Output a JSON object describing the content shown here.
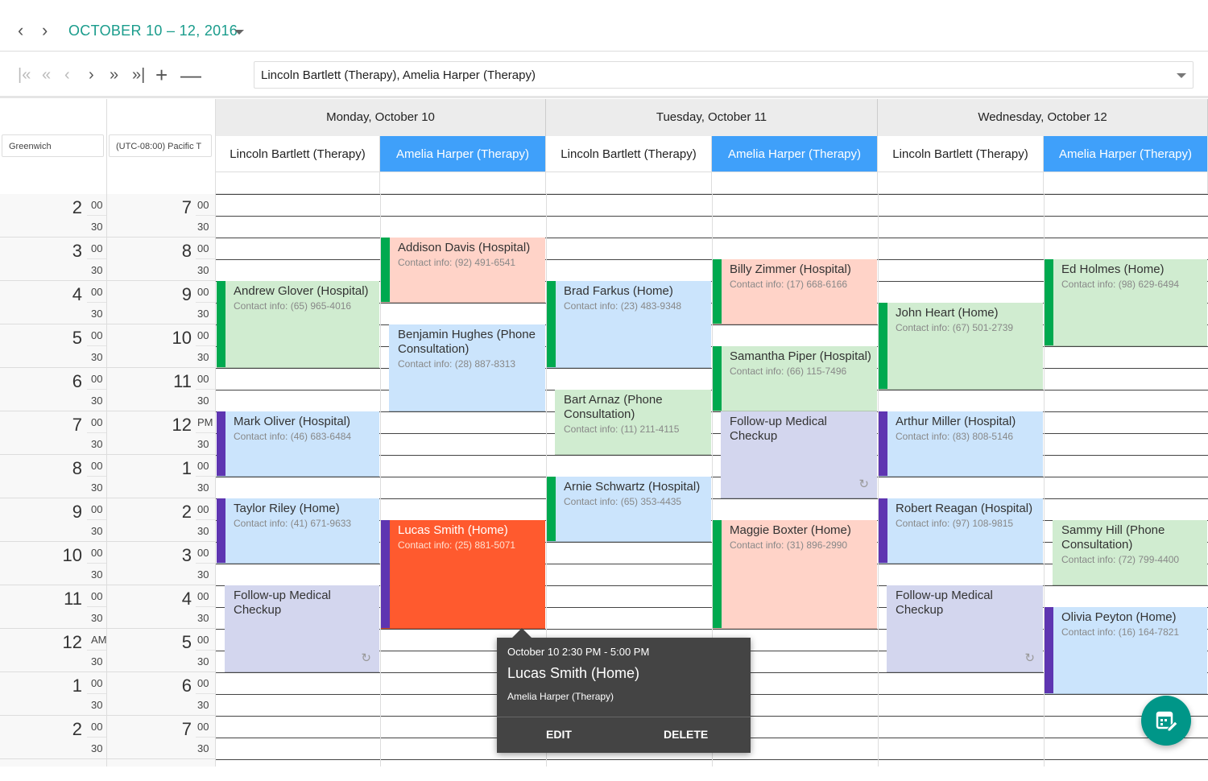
{
  "header": {
    "date_range": "OCTOBER 10 – 12, 2016",
    "prev_icon": "chevron-left-icon",
    "next_icon": "chevron-right-icon"
  },
  "toolbar": {
    "resources_value": "Lincoln Bartlett (Therapy), Amelia Harper (Therapy)"
  },
  "timezones": [
    "Greenwich",
    "(UTC-08:00) Pacific T"
  ],
  "days": [
    "Monday, October 10",
    "Tuesday, October 11",
    "Wednesday, October 12"
  ],
  "resources": [
    "Lincoln Bartlett (Therapy)",
    "Amelia Harper (Therapy)"
  ],
  "selected_resource": 1,
  "time_scale": {
    "greenwich": [
      "2",
      "3",
      "4",
      "5",
      "6",
      "7",
      "8",
      "9",
      "10",
      "11",
      "12",
      "1",
      "2"
    ],
    "pacific": [
      "7",
      "8",
      "9",
      "10",
      "11",
      "12",
      "1",
      "2",
      "3",
      "4",
      "5",
      "6",
      "7"
    ],
    "greenwich_suffix": {
      "10": "AM"
    },
    "pacific_suffix": {
      "5": "PM"
    },
    "minutes": [
      "00",
      "30"
    ]
  },
  "colors": {
    "green_bg": "#d0ecd0",
    "pink_bg": "#ffd3c8",
    "blue_bg": "#cbe4fc",
    "lavender_bg": "#d3d6ee",
    "orange_bg": "#ff5a2e",
    "green_strip": "#00a94f",
    "purple_strip": "#5e35b1",
    "selected_resource": "#3fa0fa",
    "accent": "#1a9c8c",
    "fab": "#009688"
  },
  "appointments": [
    {
      "day": 0,
      "res": 0,
      "start": 9,
      "end": 11,
      "title": "Andrew Glover (Hospital)",
      "contact": "Contact info: (65) 965-4016",
      "bg": "green_bg",
      "strip": "green_strip"
    },
    {
      "day": 0,
      "res": 0,
      "start": 12,
      "end": 13.5,
      "title": "Mark Oliver (Hospital)",
      "contact": "Contact info: (46) 683-6484",
      "bg": "blue_bg",
      "strip": "purple_strip"
    },
    {
      "day": 0,
      "res": 0,
      "start": 14,
      "end": 15.5,
      "title": "Taylor Riley (Home)",
      "contact": "Contact info: (41) 671-9633",
      "bg": "blue_bg",
      "strip": "purple_strip"
    },
    {
      "day": 0,
      "res": 0,
      "start": 16,
      "end": 18,
      "title": "Follow-up Medical Checkup",
      "contact": "",
      "bg": "lavender_bg",
      "strip": null,
      "recurring": true
    },
    {
      "day": 0,
      "res": 1,
      "start": 8,
      "end": 9.5,
      "title": "Addison Davis (Hospital)",
      "contact": "Contact info: (92) 491-6541",
      "bg": "pink_bg",
      "strip": "green_strip"
    },
    {
      "day": 0,
      "res": 1,
      "start": 10,
      "end": 12,
      "title": "Benjamin Hughes (Phone Consultation)",
      "contact": "Contact info: (28) 887-8313",
      "bg": "blue_bg",
      "strip": null
    },
    {
      "day": 0,
      "res": 1,
      "start": 14.5,
      "end": 17,
      "title": "Lucas Smith (Home)",
      "contact": "Contact info: (25) 881-5071",
      "bg": "orange_bg",
      "strip": "purple_strip",
      "selected": true
    },
    {
      "day": 1,
      "res": 0,
      "start": 9,
      "end": 11,
      "title": "Brad Farkus (Home)",
      "contact": "Contact info: (23) 483-9348",
      "bg": "blue_bg",
      "strip": "green_strip"
    },
    {
      "day": 1,
      "res": 0,
      "start": 11.5,
      "end": 13,
      "title": "Bart Arnaz (Phone Consultation)",
      "contact": "Contact info: (11) 211-4115",
      "bg": "green_bg",
      "strip": null
    },
    {
      "day": 1,
      "res": 0,
      "start": 13.5,
      "end": 15,
      "title": "Arnie Schwartz (Hospital)",
      "contact": "Contact info: (65) 353-4435",
      "bg": "blue_bg",
      "strip": "green_strip"
    },
    {
      "day": 1,
      "res": 1,
      "start": 8.5,
      "end": 10,
      "title": "Billy Zimmer (Hospital)",
      "contact": "Contact info: (17) 668-6166",
      "bg": "pink_bg",
      "strip": "green_strip"
    },
    {
      "day": 1,
      "res": 1,
      "start": 10.5,
      "end": 12,
      "title": "Samantha Piper (Hospital)",
      "contact": "Contact info: (66) 115-7496",
      "bg": "green_bg",
      "strip": "green_strip"
    },
    {
      "day": 1,
      "res": 1,
      "start": 12,
      "end": 14,
      "title": "Follow-up Medical Checkup",
      "contact": "",
      "bg": "lavender_bg",
      "strip": null,
      "recurring": true
    },
    {
      "day": 1,
      "res": 1,
      "start": 14.5,
      "end": 17,
      "title": "Maggie Boxter (Home)",
      "contact": "Contact info: (31) 896-2990",
      "bg": "pink_bg",
      "strip": "green_strip"
    },
    {
      "day": 2,
      "res": 0,
      "start": 9.5,
      "end": 11.5,
      "title": "John Heart (Home)",
      "contact": "Contact info: (67) 501-2739",
      "bg": "green_bg",
      "strip": "green_strip"
    },
    {
      "day": 2,
      "res": 0,
      "start": 12,
      "end": 13.5,
      "title": "Arthur Miller (Hospital)",
      "contact": "Contact info: (83) 808-5146",
      "bg": "blue_bg",
      "strip": "purple_strip"
    },
    {
      "day": 2,
      "res": 0,
      "start": 14,
      "end": 15.5,
      "title": "Robert Reagan (Hospital)",
      "contact": "Contact info: (97) 108-9815",
      "bg": "blue_bg",
      "strip": "purple_strip"
    },
    {
      "day": 2,
      "res": 0,
      "start": 16,
      "end": 18,
      "title": "Follow-up Medical Checkup",
      "contact": "",
      "bg": "lavender_bg",
      "strip": null,
      "recurring": true
    },
    {
      "day": 2,
      "res": 1,
      "start": 8.5,
      "end": 10.5,
      "title": "Ed Holmes (Home)",
      "contact": "Contact info: (98) 629-6494",
      "bg": "green_bg",
      "strip": "green_strip"
    },
    {
      "day": 2,
      "res": 1,
      "start": 14.5,
      "end": 16,
      "title": "Sammy Hill (Phone Consultation)",
      "contact": "Contact info: (72) 799-4400",
      "bg": "green_bg",
      "strip": null
    },
    {
      "day": 2,
      "res": 1,
      "start": 16.5,
      "end": 18.5,
      "title": "Olivia Peyton (Home)",
      "contact": "Contact info: (16) 164-7821",
      "bg": "blue_bg",
      "strip": "purple_strip"
    }
  ],
  "tooltip": {
    "time": "October 10 2:30 PM - 5:00 PM",
    "title": "Lucas Smith (Home)",
    "resource": "Amelia Harper (Therapy)",
    "edit": "EDIT",
    "delete": "DELETE"
  },
  "fab": {
    "icon": "calendar-edit-icon"
  }
}
